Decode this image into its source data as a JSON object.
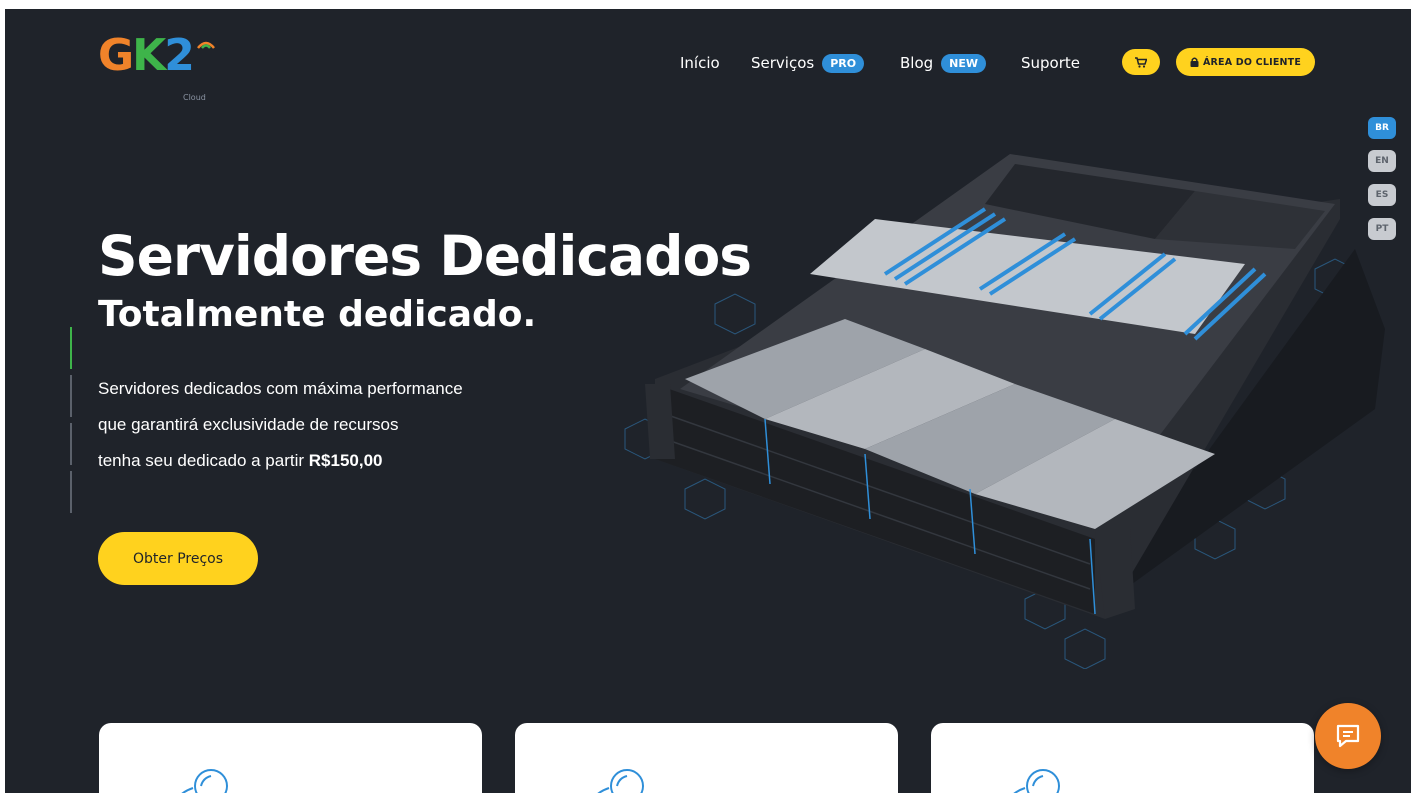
{
  "brand": {
    "logo_text": "GK2",
    "logo_subtext": "Cloud",
    "colors": {
      "orange": "#f0832a",
      "green": "#3eb44a",
      "blue": "#2f8fd9",
      "yellow": "#ffd21e",
      "background": "#1f232a"
    }
  },
  "nav": {
    "items": [
      {
        "label": "Início"
      },
      {
        "label": "Serviços",
        "badge": "PRO"
      },
      {
        "label": "Blog",
        "badge": "NEW"
      },
      {
        "label": "Suporte"
      }
    ],
    "cart_icon": "cart-icon",
    "client_area_label": "ÁREA DO CLIENTE",
    "client_area_icon": "lock-icon"
  },
  "languages": [
    {
      "code": "BR",
      "active": true
    },
    {
      "code": "EN",
      "active": false
    },
    {
      "code": "ES",
      "active": false
    },
    {
      "code": "PT",
      "active": false
    }
  ],
  "hero": {
    "title": "Servidores Dedicados",
    "subtitle": "Totalmente dedicado.",
    "desc_line1": "Servidores dedicados com máxima performance",
    "desc_line2": "que garantirá exclusividade de recursos",
    "desc_line3_prefix": "tenha seu dedicado a partir ",
    "desc_price": "R$150,00",
    "cta_label": "Obter Preços"
  },
  "cards": [
    {
      "icon": "server-icon"
    },
    {
      "icon": "server-icon"
    },
    {
      "icon": "server-icon"
    }
  ],
  "chat": {
    "icon": "chat-icon"
  }
}
